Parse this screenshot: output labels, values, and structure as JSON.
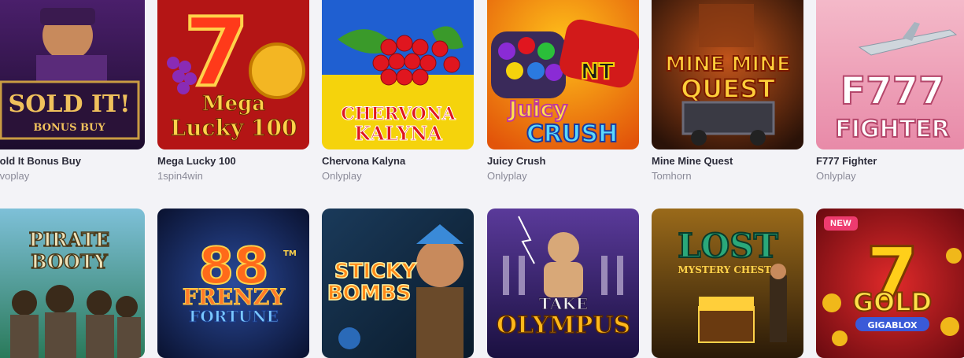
{
  "games": [
    {
      "title": "Sold It Bonus Buy",
      "provider": "Evoplay",
      "art": [
        "SOLD IT!",
        "BONUS BUY"
      ]
    },
    {
      "title": "Mega Lucky 100",
      "provider": "1spin4win",
      "art": [
        "Mega",
        "Lucky 100"
      ]
    },
    {
      "title": "Chervona Kalyna",
      "provider": "Onlyplay",
      "art": [
        "CHERVONA",
        "KALYNA"
      ]
    },
    {
      "title": "Juicy Crush",
      "provider": "Onlyplay",
      "art": [
        "Juicy",
        "CRUSH"
      ]
    },
    {
      "title": "Mine Mine Quest",
      "provider": "Tomhorn",
      "art": [
        "MINE MINE",
        "QUEST"
      ]
    },
    {
      "title": "F777 Fighter",
      "provider": "Onlyplay",
      "art": [
        "F777",
        "FIGHTER"
      ]
    },
    {
      "art": [
        "PIRATE",
        "BOOTY"
      ]
    },
    {
      "art": [
        "88",
        "FRENZY",
        "FORTUNE"
      ]
    },
    {
      "art": [
        "STICKY",
        "BOMBS"
      ]
    },
    {
      "art": [
        "TAKE",
        "OLYMPUS"
      ]
    },
    {
      "art": [
        "LOST",
        "MYSTERY CHESTS"
      ]
    },
    {
      "art": [
        "7",
        "GOLD",
        "GIGABLOX"
      ],
      "badge": "NEW"
    }
  ]
}
